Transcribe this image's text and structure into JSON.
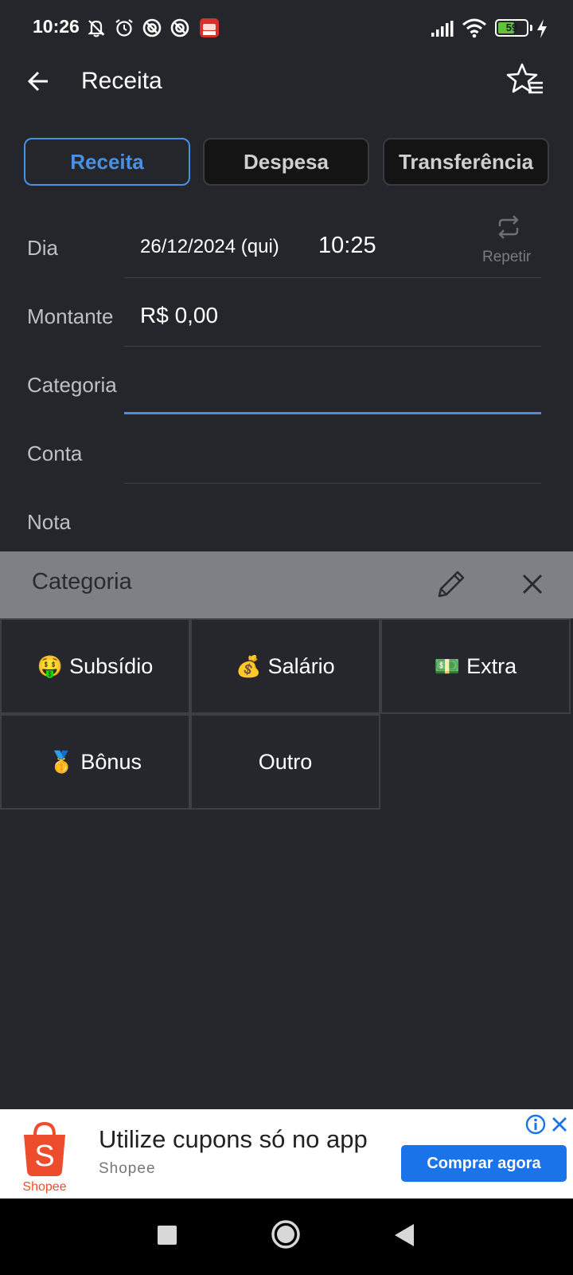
{
  "status_bar": {
    "time": "10:26",
    "battery": "59",
    "battery_level": 0.59,
    "icons": [
      "bell-off-icon",
      "alarm-icon",
      "dnd-icon",
      "dnd-icon",
      "app-notification-icon",
      "signal-icon",
      "wifi-icon",
      "battery-icon",
      "charging-icon"
    ]
  },
  "app_bar": {
    "title": "Receita",
    "back_icon": "arrow-left-icon",
    "action_icon": "star-list-icon"
  },
  "tabs": [
    {
      "label": "Receita",
      "active": true
    },
    {
      "label": "Despesa",
      "active": false
    },
    {
      "label": "Transferência",
      "active": false
    }
  ],
  "form": {
    "dia_label": "Dia",
    "date": "26/12/2024 (qui)",
    "time": "10:25",
    "repeat_label": "Repetir",
    "montante_label": "Montante",
    "montante_value": "R$ 0,00",
    "categoria_label": "Categoria",
    "conta_label": "Conta",
    "nota_label": "Nota"
  },
  "category_panel": {
    "title": "Categoria",
    "items": [
      {
        "emoji": "🤑",
        "label": "Subsídio"
      },
      {
        "emoji": "💰",
        "label": "Salário"
      },
      {
        "emoji": "💵",
        "label": "Extra"
      },
      {
        "emoji": "🥇",
        "label": "Bônus"
      },
      {
        "emoji": "",
        "label": "Outro"
      }
    ]
  },
  "ad": {
    "logo_text": "Shopee",
    "headline": "Utilize cupons só no app",
    "brand": "Shopee",
    "cta": "Comprar agora"
  },
  "colors": {
    "background": "#25262b",
    "accent": "#4a90e2",
    "panel_header": "#7e8085",
    "ad_cta": "#1a73e8",
    "shopee_orange": "#ee4d2d"
  }
}
